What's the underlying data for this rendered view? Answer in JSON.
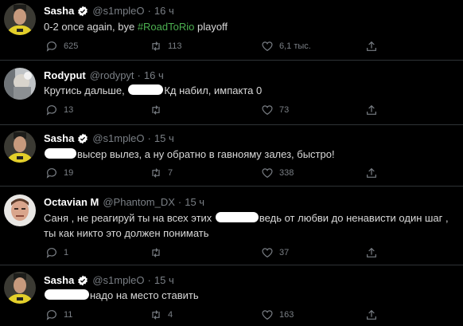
{
  "tweets": [
    {
      "name": "Sasha",
      "verified": true,
      "handle": "@s1mpleO",
      "time": "16 ч",
      "text_main": "0-2 once again, bye ",
      "hashtag": "#RoadToRio",
      "text_after": " playoff",
      "reply_count": "625",
      "retweet_count": "113",
      "like_count": "6,1 тыс."
    },
    {
      "name": "Rodyput",
      "verified": false,
      "handle": "@rodypyt",
      "time": "16 ч",
      "text_before": "Крутись дальше, ",
      "text_after": "Кд набил, импакта 0",
      "reply_count": "13",
      "retweet_count": "",
      "like_count": "73"
    },
    {
      "name": "Sasha",
      "verified": true,
      "handle": "@s1mpleO",
      "time": "15 ч",
      "text_after": "высер вылез, а ну обратно в гавноямy залез, быстро!",
      "reply_count": "19",
      "retweet_count": "7",
      "like_count": "338"
    },
    {
      "name": "Octavian M",
      "verified": false,
      "handle": "@Phantom_DX",
      "time": "15 ч",
      "line1_before": "Саня , не реагируй ты на всех этих ",
      "line1_after": "ведь от любви до ненависти один шаг ,",
      "line2": "ты как никто это должен понимать",
      "reply_count": "1",
      "retweet_count": "",
      "like_count": "37"
    },
    {
      "name": "Sasha",
      "verified": true,
      "handle": "@s1mpleO",
      "time": "15 ч",
      "text_after": "надо на место ставить",
      "reply_count": "11",
      "retweet_count": "4",
      "like_count": "163"
    }
  ],
  "colors": {
    "background": "#000000",
    "text": "#d9d9d9",
    "muted": "#7a7f85",
    "hashtag": "#4caf50",
    "divider": "#2f3336",
    "verified": "#ffffff"
  }
}
